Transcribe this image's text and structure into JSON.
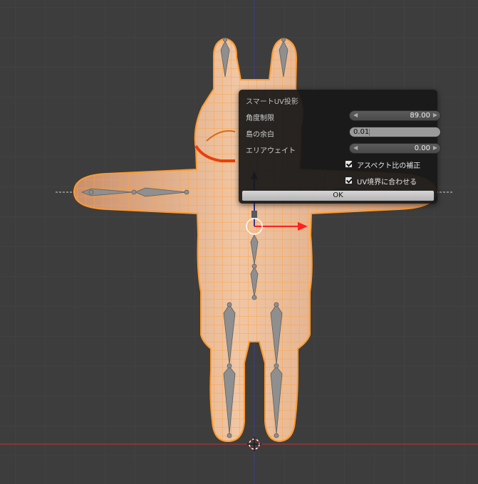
{
  "dialog": {
    "title": "スマートUV投影",
    "angle_limit": {
      "label": "角度制限",
      "value": "89.00"
    },
    "island_margin": {
      "label": "島の余白",
      "value": "0.01"
    },
    "area_weight": {
      "label": "エリアウェイト",
      "value": "0.00"
    },
    "correct_aspect": {
      "label": "アスペクト比の補正",
      "checked": true
    },
    "scale_to_bounds": {
      "label": "UV境界に合わせる",
      "checked": true
    },
    "ok_label": "OK"
  },
  "colors": {
    "background": "#3d3d3d",
    "mesh_fill": "#e2b590",
    "wire_selected": "#ff9a2e",
    "active_edge": "#e8400c",
    "axis_x": "#c83232",
    "axis_y": "#3a3a8a",
    "gizmo_x": "#ff2020"
  }
}
